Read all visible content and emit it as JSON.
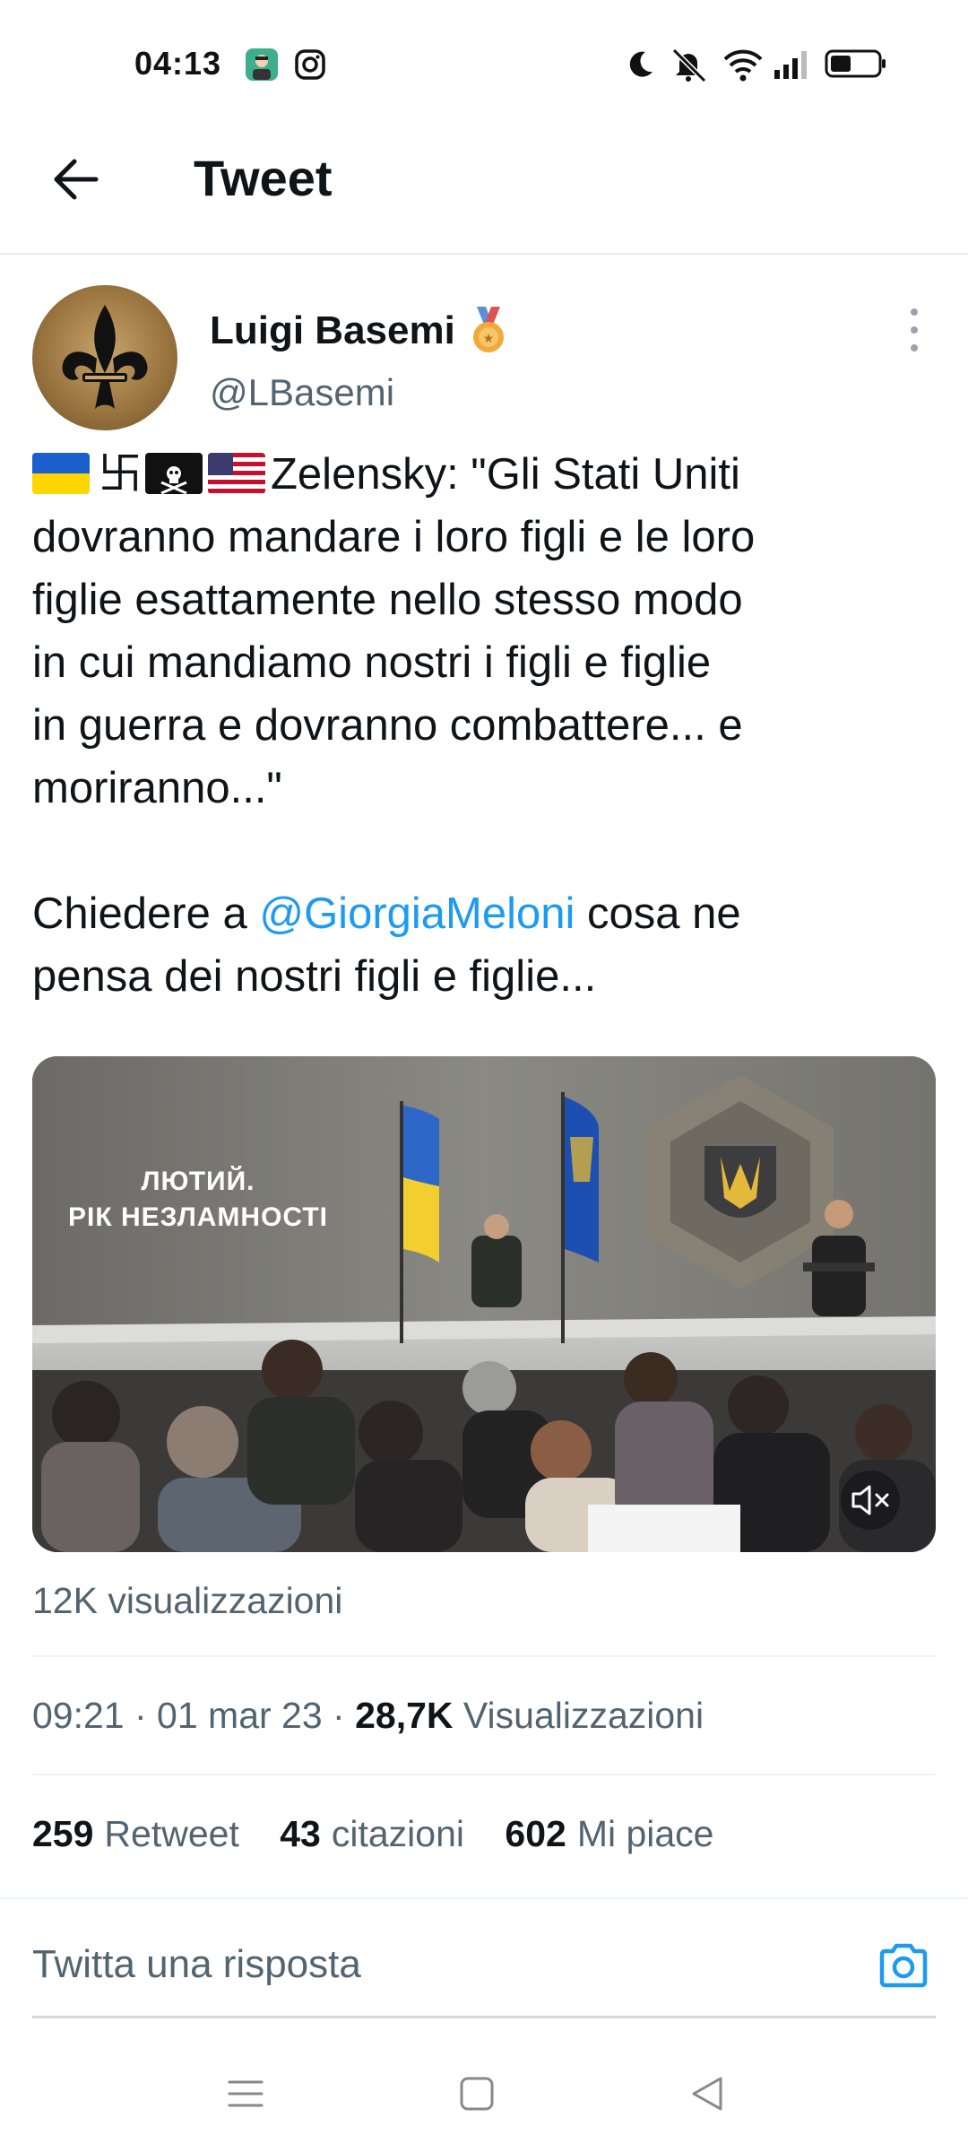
{
  "status_bar": {
    "time": "04:13",
    "left_icons": [
      "app-avatar-icon",
      "instagram-icon"
    ],
    "right_icons": [
      "moon-icon",
      "silent-icon",
      "wifi-icon",
      "signal-icon",
      "battery-icon"
    ]
  },
  "header": {
    "title": "Tweet",
    "back_icon": "arrow-left-icon"
  },
  "tweet": {
    "author_name": "Luigi Basemi",
    "author_handle": "@LBasemi",
    "badge_icon": "medal-icon",
    "text": {
      "line1_text": "Zelensky: \"Gli Stati Uniti",
      "line1_emoji": [
        "flag-ukraine",
        "卐",
        "pirate-flag",
        "flag-usa"
      ],
      "swastika_glyph": "卐",
      "line2": "dovranno mandare i loro figli e le loro",
      "line3": "figlie esattamente nello stesso modo",
      "line4": "in cui mandiamo nostri i figli e figlie",
      "line5": "in guerra e dovranno combattere... e",
      "line6": "moriranno...\"",
      "line7_before": "Chiedere a ",
      "mention": "@GiorgiaMeloni",
      "line7_after": " cosa ne",
      "line8": "pensa dei nostri figli e figlie..."
    },
    "media": {
      "caption_line1": "ЛЮТИЙ.",
      "caption_line2": "РІК НЕЗЛАМНОСТІ",
      "mute_icon": "muted-speaker-icon"
    },
    "views_small": "12K visualizzazioni",
    "meta": {
      "time": "09:21",
      "date": "01 mar 23",
      "views_count": "28,7K",
      "views_label": "Visualizzazioni"
    },
    "stats": {
      "retweets_count": "259",
      "retweets_label": "Retweet",
      "quotes_count": "43",
      "quotes_label": "citazioni",
      "likes_count": "602",
      "likes_label": "Mi piace"
    }
  },
  "reply": {
    "placeholder": "Twitta una risposta",
    "camera_icon": "camera-icon"
  },
  "nav_bar": {
    "icons": [
      "menu-icon",
      "home-square-icon",
      "back-triangle-icon"
    ]
  },
  "colors": {
    "link": "#1d9bf0",
    "secondary_text": "#536471",
    "primary_text": "#0f1419"
  }
}
